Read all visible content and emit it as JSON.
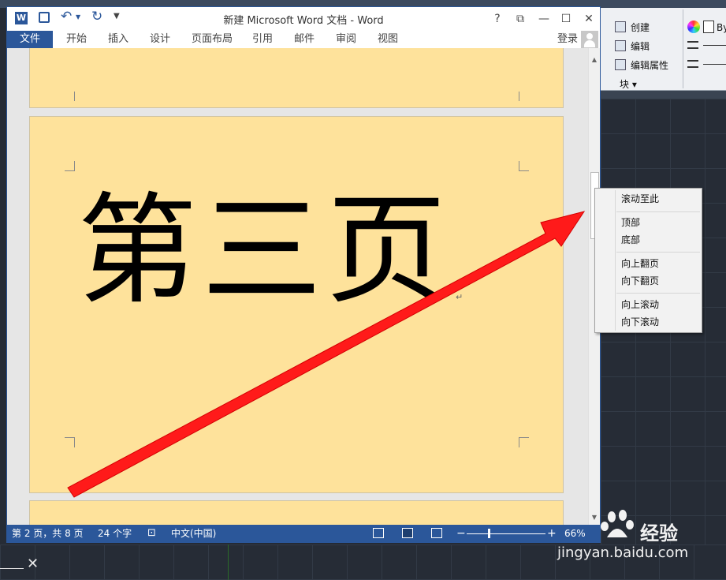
{
  "word": {
    "title": "新建 Microsoft Word 文档 - Word",
    "logo_letter": "W",
    "window_buttons": {
      "help": "?",
      "ribbon_options": "⧉",
      "minimize": "—",
      "maximize": "☐",
      "close": "✕"
    },
    "tabs": [
      "文件",
      "开始",
      "插入",
      "设计",
      "页面布局",
      "引用",
      "邮件",
      "审阅",
      "视图"
    ],
    "login": "登录",
    "page_heading": "第三页",
    "status": {
      "page": "第 2 页，共 8 页",
      "words": "24 个字",
      "language": "中文(中国)",
      "zoom": "66%"
    }
  },
  "context_menu": {
    "groups": [
      [
        "滚动至此"
      ],
      [
        "顶部",
        "底部"
      ],
      [
        "向上翻页",
        "向下翻页"
      ],
      [
        "向上滚动",
        "向下滚动"
      ]
    ]
  },
  "cad_ribbon": {
    "items": [
      "创建",
      "编辑",
      "编辑属性"
    ],
    "group_label": "块 ▾",
    "by_label": "By"
  },
  "watermark": {
    "brand": "经验",
    "url": "jingyan.baidu.com"
  },
  "colors": {
    "word_blue": "#2b579a",
    "page_bg": "#fee29b",
    "arrow": "#ff1a1a"
  }
}
